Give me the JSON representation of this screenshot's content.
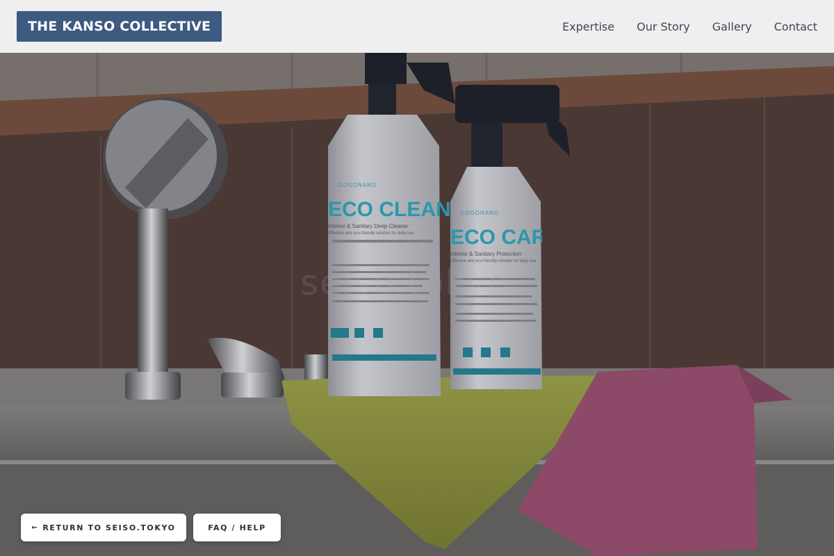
{
  "header": {
    "brand": "THE KANSO COLLECTIVE",
    "nav": [
      "Expertise",
      "Our Story",
      "Gallery",
      "Contact"
    ]
  },
  "hero": {
    "bottle_left": {
      "brand": "GOGONANO",
      "name": "ECO CLEAN",
      "subtitle": "Interior & Sanitary Deep Cleaner",
      "tagline": "Effective and eco-friendly solution for daily use"
    },
    "bottle_right": {
      "brand": "GOGONANO",
      "name": "ECO CARE",
      "subtitle": "Interior & Sanitary Protection",
      "tagline": "Effective and eco-friendly solution for daily use"
    },
    "watermark": "seiso.tokyo"
  },
  "actions": {
    "return_arrow": "←",
    "return_label": "RETURN TO SEISO.TOKYO",
    "faq_label": "FAQ / HELP"
  },
  "colors": {
    "brand_bg": "#3d5a80",
    "nav_text": "#3b4654",
    "header_bg": "#efefef",
    "bottle_accent": "#2a9db0"
  }
}
